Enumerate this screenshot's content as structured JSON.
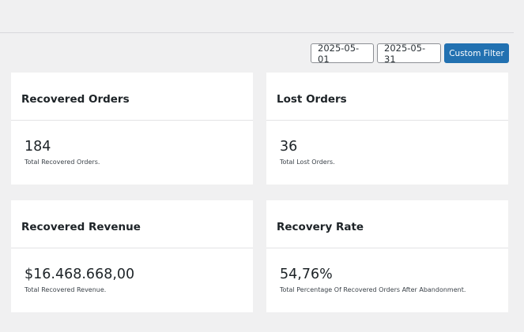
{
  "filters": {
    "start_date": "2025-05-01",
    "end_date": "2025-05-31",
    "button_label": "Custom Filter",
    "button_color": "#2271b1"
  },
  "cards": {
    "recovered_orders": {
      "title": "Recovered Orders",
      "value": "184",
      "description": "Total Recovered Orders."
    },
    "lost_orders": {
      "title": "Lost Orders",
      "value": "36",
      "description": "Total Lost Orders."
    },
    "recovered_revenue": {
      "title": "Recovered Revenue",
      "value": "$16.468.668,00",
      "description": "Total Recovered Revenue."
    },
    "recovery_rate": {
      "title": "Recovery Rate",
      "value": "54,76%",
      "description": "Total Percentage Of Recovered Orders After Abandonment."
    }
  }
}
